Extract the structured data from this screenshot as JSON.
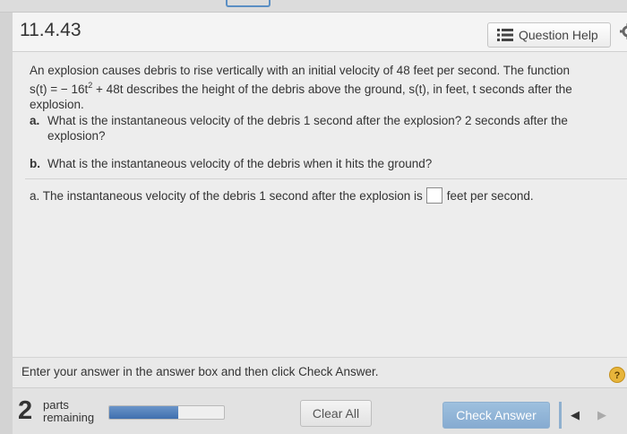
{
  "header": {
    "problem_number": "11.4.43",
    "help_label": "Question Help"
  },
  "question": {
    "intro_1": "An explosion causes debris to rise vertically with an initial velocity of 48 feet per second. The function",
    "intro_2a": "s(t) = − 16t",
    "intro_2_sup": "2",
    "intro_2b": " + 48t describes the height of the debris above the ground, s(t), in feet, t seconds after the",
    "intro_3": "explosion.",
    "parts": [
      {
        "label": "a.",
        "text": "What is the instantaneous velocity of the debris 1 second after the explosion? 2 seconds after the explosion?"
      },
      {
        "label": "b.",
        "text": "What is the instantaneous velocity of the debris when it hits the ground?"
      }
    ]
  },
  "answer": {
    "prefix": "a. The instantaneous velocity of the debris 1 second after the explosion is",
    "value": "",
    "suffix": "feet per second."
  },
  "instruction": {
    "text": "Enter your answer in the answer box and then click Check Answer.",
    "help_glyph": "?"
  },
  "footer": {
    "parts_count": "2",
    "parts_label_1": "parts",
    "parts_label_2": "remaining",
    "progress_fraction": 0.6,
    "clear_label": "Clear All",
    "check_label": "Check Answer",
    "prev_glyph": "◀",
    "next_glyph": "▶"
  },
  "colors": {
    "accent": "#4b79b5",
    "check_button": "#8fb3d6",
    "help_icon": "#e7b53b"
  }
}
